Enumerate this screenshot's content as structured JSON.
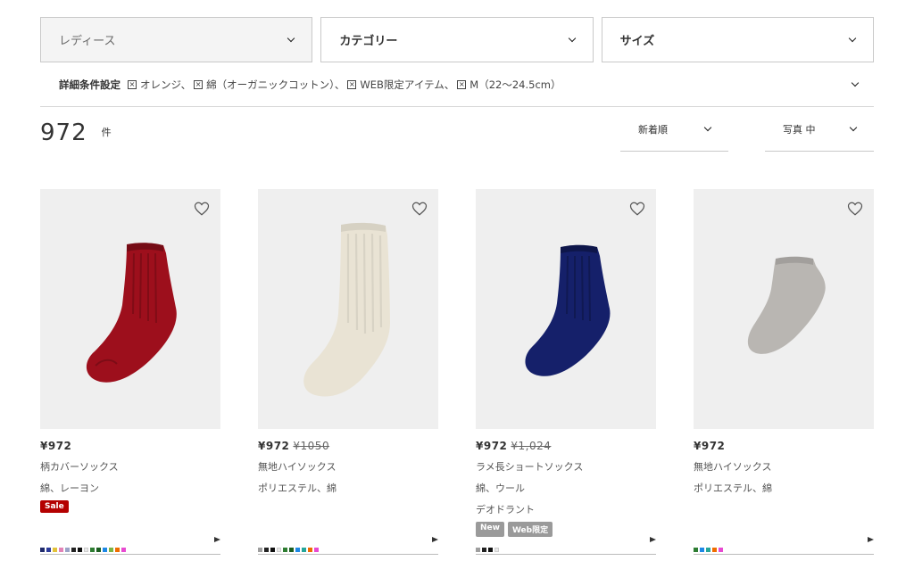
{
  "filters": {
    "gender": "レディース",
    "category": "カテゴリー",
    "size": "サイズ"
  },
  "detail": {
    "title": "詳細条件設定",
    "chips": [
      "オレンジ、",
      "綿（オーガニックコットン）、",
      "WEB限定アイテム、",
      "M（22〜24.5cm）"
    ],
    "chip_remove_symbol": "×"
  },
  "results": {
    "count": "972",
    "unit": "件"
  },
  "sort": {
    "order": "新着順",
    "view": "写真 中"
  },
  "products": [
    {
      "price": "¥972",
      "was": "",
      "name": "柄カバーソックス",
      "material": "綿、レーヨン",
      "extra": "",
      "tags": [
        "Sale"
      ],
      "sock_color": "#9d0f1c",
      "swatches": [
        "#1f2a6b",
        "#2b3a9a",
        "#e2c23a",
        "#e383b7",
        "#9ba3c7",
        "#222222",
        "#101010",
        "#e9e9e9",
        "#2e7d32",
        "#1b5e20",
        "#1e88e5",
        "#7cb342",
        "#ef6c00",
        "#e84ad1"
      ]
    },
    {
      "price": "¥972",
      "was": "¥1050",
      "name": "無地ハイソックス",
      "material": "ポリエステル、綿",
      "extra": "",
      "tags": [],
      "sock_color": "#e9e3d4",
      "swatches": [
        "#9e9e9e",
        "#222222",
        "#101010",
        "#e9e9e9",
        "#2e7d32",
        "#1b5e20",
        "#1e88e5",
        "#26a69a",
        "#ef6c00",
        "#e84ad1"
      ]
    },
    {
      "price": "¥972",
      "was": "¥1,024",
      "name": "ラメ長ショートソックス",
      "material": "綿、ウール",
      "extra": "デオドラント",
      "tags": [
        "New",
        "Web限定"
      ],
      "sock_color": "#15206a",
      "swatches": [
        "#9e9e9e",
        "#222222",
        "#101010",
        "#e9e9e9"
      ]
    },
    {
      "price": "¥972",
      "was": "",
      "name": "無地ハイソックス",
      "material": "ポリエステル、綿",
      "extra": "",
      "tags": [],
      "sock_color": "#b9b6b2",
      "swatches": [
        "#2e7d32",
        "#1e88e5",
        "#26a69a",
        "#ef6c00",
        "#e84ad1"
      ]
    }
  ]
}
